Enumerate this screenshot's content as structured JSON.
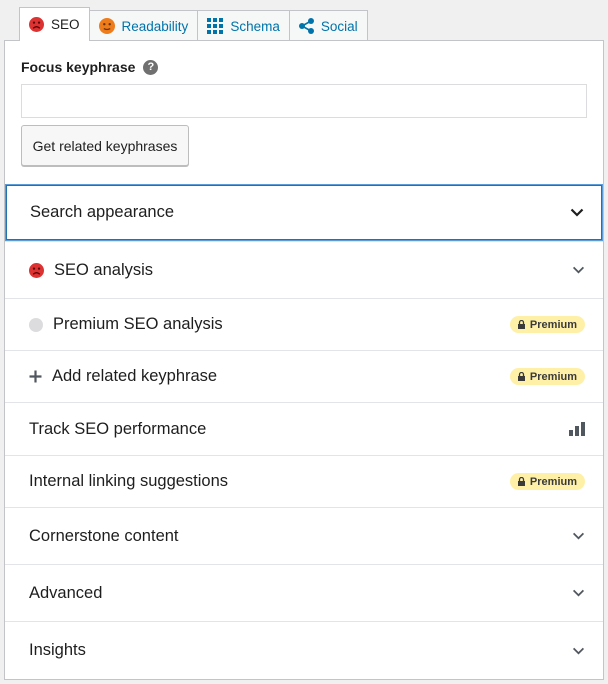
{
  "tabs": [
    {
      "label": "SEO",
      "icon": "sad-face-red-icon",
      "active": true
    },
    {
      "label": "Readability",
      "icon": "neutral-face-orange-icon"
    },
    {
      "label": "Schema",
      "icon": "grid-icon"
    },
    {
      "label": "Social",
      "icon": "share-icon"
    }
  ],
  "focus_keyphrase": {
    "label": "Focus keyphrase",
    "help_icon": "question-mark-icon",
    "value": "",
    "placeholder": ""
  },
  "related_button": {
    "label": "Get related keyphrases"
  },
  "sections": [
    {
      "label": "Search appearance",
      "end": "chevron-down-icon",
      "focused": true
    },
    {
      "label": "SEO analysis",
      "lead": "sad-face-red-icon",
      "end": "chevron-down-icon"
    },
    {
      "label": "Premium SEO analysis",
      "lead": "gray-dot-icon",
      "end": "premium-badge"
    },
    {
      "label": "Add related keyphrase",
      "lead": "plus-icon",
      "end": "premium-badge"
    },
    {
      "label": "Track SEO performance",
      "end": "bar-chart-icon"
    },
    {
      "label": "Internal linking suggestions",
      "end": "premium-badge"
    },
    {
      "label": "Cornerstone content",
      "end": "chevron-down-icon"
    },
    {
      "label": "Advanced",
      "end": "chevron-down-icon"
    },
    {
      "label": "Insights",
      "end": "chevron-down-icon"
    }
  ],
  "premium_label": "Premium",
  "colors": {
    "link_blue": "#0073aa",
    "error_red": "#dc3232",
    "warn_orange": "#ee7c1b",
    "premium_yellow": "#fff0a8",
    "focus_blue": "#5b9dd9"
  }
}
